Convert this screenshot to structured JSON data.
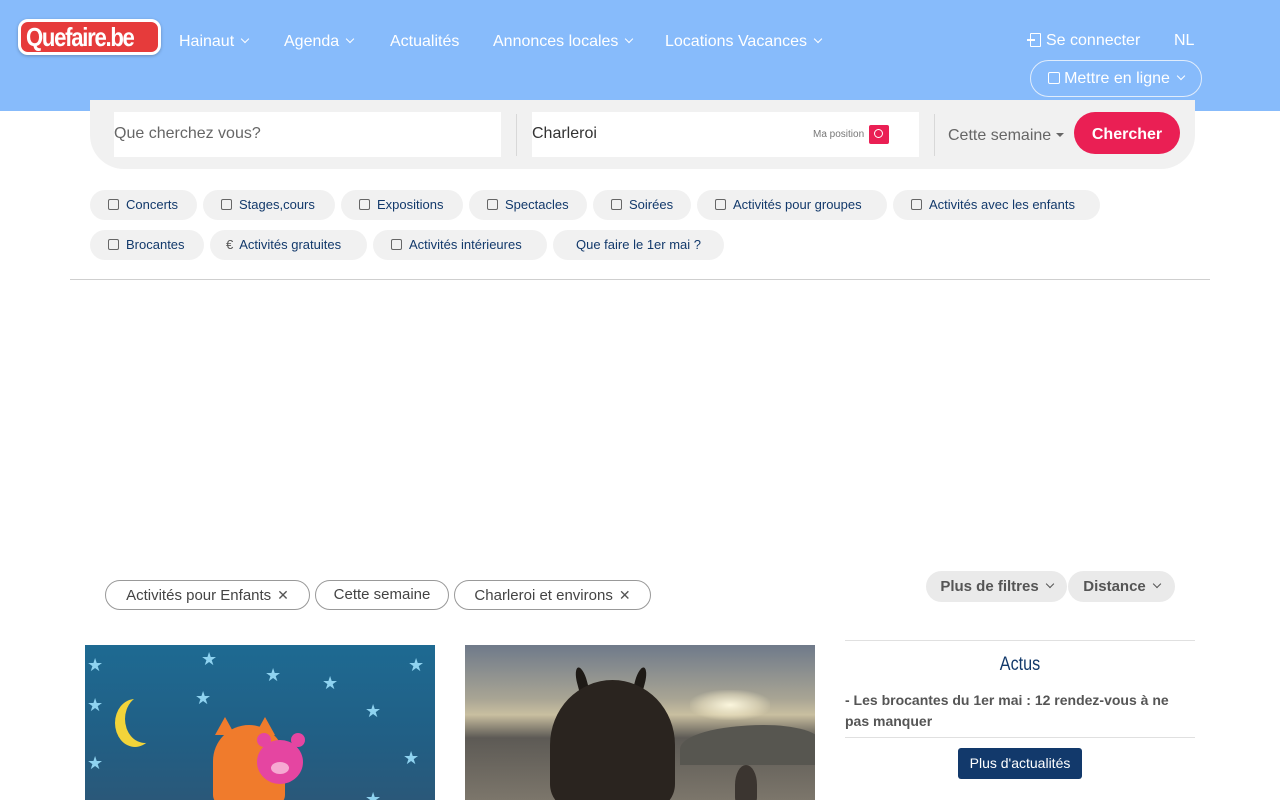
{
  "header": {
    "logo_text": "Quefaire.be",
    "nav": [
      {
        "label": "Hainaut"
      },
      {
        "label": "Agenda"
      },
      {
        "label": "Actualités"
      },
      {
        "label": "Annonces locales"
      },
      {
        "label": "Locations Vacances"
      }
    ],
    "login_label": "Se connecter",
    "language": "NL",
    "publish_label": "Mettre en ligne"
  },
  "search": {
    "what_placeholder": "Que cherchez vous?",
    "where_value": "Charleroi",
    "my_position_label": "Ma position",
    "period_label": "Cette semaine",
    "submit_label": "Chercher"
  },
  "categories": [
    {
      "label": "Concerts"
    },
    {
      "label": "Stages,cours"
    },
    {
      "label": "Expositions"
    },
    {
      "label": "Spectacles"
    },
    {
      "label": "Soirées"
    },
    {
      "label": "Activités pour groupes"
    },
    {
      "label": "Activités avec les enfants"
    },
    {
      "label": "Brocantes"
    },
    {
      "label": "Activités gratuites"
    },
    {
      "label": "Activités intérieures"
    },
    {
      "label": "Que faire le 1er mai ?"
    }
  ],
  "filters": {
    "active": [
      {
        "label": "Activités pour Enfants",
        "removable": true
      },
      {
        "label": "Cette semaine",
        "removable": false
      },
      {
        "label": "Charleroi et environs",
        "removable": true
      }
    ],
    "more_filters_label": "Plus de filtres",
    "distance_label": "Distance"
  },
  "actus": {
    "title": "Actus",
    "items": [
      {
        "text": "- Les brocantes du 1er mai : 12 rendez-vous à ne pas manquer"
      }
    ],
    "more_label": "Plus d'actualités"
  },
  "colors": {
    "header_bg": "#87bbfb",
    "accent": "#ea1f54",
    "navy": "#12396b"
  }
}
